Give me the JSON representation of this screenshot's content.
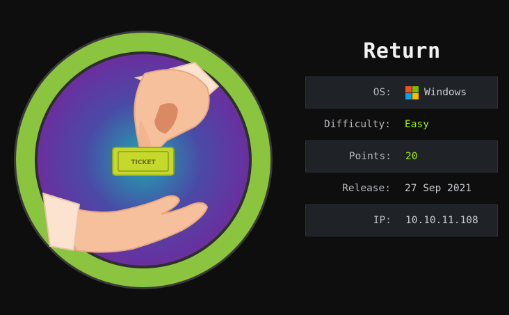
{
  "machine": {
    "name": "Return",
    "badge_text": "TICKET"
  },
  "info": {
    "os_label": "OS:",
    "os_value": "Windows",
    "os_icon": "windows-logo-icon",
    "difficulty_label": "Difficulty:",
    "difficulty_value": "Easy",
    "points_label": "Points:",
    "points_value": "20",
    "release_label": "Release:",
    "release_value": "27 Sep 2021",
    "ip_label": "IP:",
    "ip_value": "10.10.11.108"
  },
  "colors": {
    "background": "#0e0e0e",
    "accent_green": "#9fef00",
    "badge_ring": "#8bc43f",
    "windows_red": "#f25022",
    "windows_green": "#7fba00",
    "windows_blue": "#00a4ef",
    "windows_yellow": "#ffb900"
  }
}
